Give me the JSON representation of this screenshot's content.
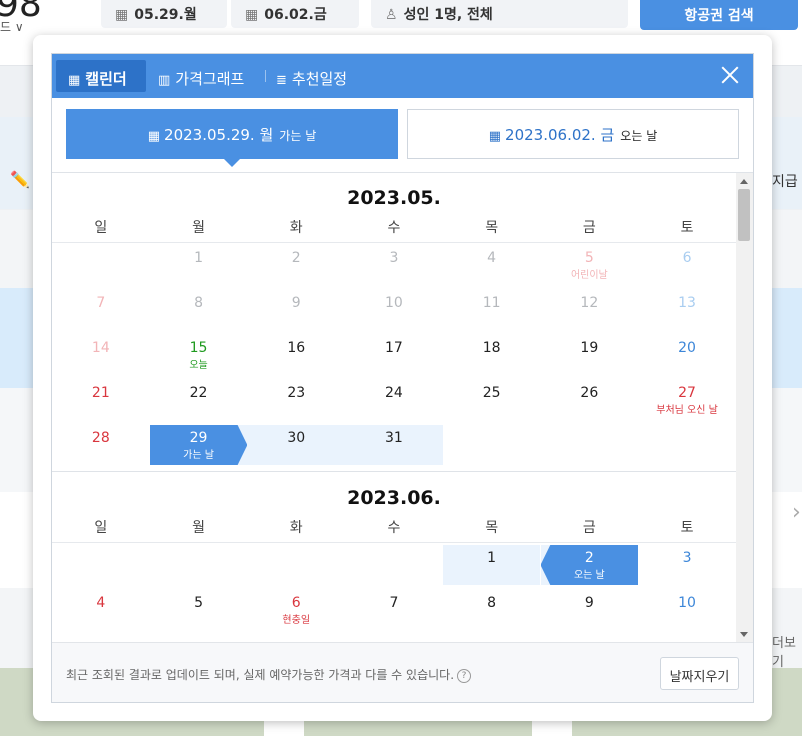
{
  "header": {
    "logo_fragment": "98",
    "logo_sub": "드 ∨",
    "depart_field": "05.29.월",
    "return_field": "06.02.금",
    "passenger_field": "성인 1명, 전체",
    "search_button": "항공권 검색"
  },
  "background": {
    "right_text_1": "지급",
    "right_text_2": "더보기",
    "chevron": "›"
  },
  "popup": {
    "tabs": [
      "캘린더",
      "가격그래프",
      "추천일정"
    ],
    "departure": {
      "date": "2023.05.29.",
      "weekday": "월",
      "label": "가는 날"
    },
    "return": {
      "date": "2023.06.02.",
      "weekday": "금",
      "label": "오는 날"
    },
    "weekdays": [
      "일",
      "월",
      "화",
      "수",
      "목",
      "금",
      "토"
    ],
    "footer_note": "최근 조회된 결과로 업데이트 되며, 실제 예약가능한 가격과 다를 수 있습니다.",
    "help_glyph": "?",
    "clear_button": "날짜지우기",
    "months": [
      {
        "title": "2023.05.",
        "days": [
          {
            "d": "1",
            "col": 1,
            "row": 0,
            "state": "past"
          },
          {
            "d": "2",
            "col": 2,
            "row": 0,
            "state": "past"
          },
          {
            "d": "3",
            "col": 3,
            "row": 0,
            "state": "past"
          },
          {
            "d": "4",
            "col": 4,
            "row": 0,
            "state": "past"
          },
          {
            "d": "5",
            "col": 5,
            "row": 0,
            "state": "past hol",
            "label": "어린이날"
          },
          {
            "d": "6",
            "col": 6,
            "row": 0,
            "state": "past sat"
          },
          {
            "d": "7",
            "col": 0,
            "row": 1,
            "state": "past sun"
          },
          {
            "d": "8",
            "col": 1,
            "row": 1,
            "state": "past"
          },
          {
            "d": "9",
            "col": 2,
            "row": 1,
            "state": "past"
          },
          {
            "d": "10",
            "col": 3,
            "row": 1,
            "state": "past"
          },
          {
            "d": "11",
            "col": 4,
            "row": 1,
            "state": "past"
          },
          {
            "d": "12",
            "col": 5,
            "row": 1,
            "state": "past"
          },
          {
            "d": "13",
            "col": 6,
            "row": 1,
            "state": "past sat"
          },
          {
            "d": "14",
            "col": 0,
            "row": 2,
            "state": "past sun"
          },
          {
            "d": "15",
            "col": 1,
            "row": 2,
            "state": "today",
            "label": "오늘"
          },
          {
            "d": "16",
            "col": 2,
            "row": 2,
            "state": ""
          },
          {
            "d": "17",
            "col": 3,
            "row": 2,
            "state": ""
          },
          {
            "d": "18",
            "col": 4,
            "row": 2,
            "state": ""
          },
          {
            "d": "19",
            "col": 5,
            "row": 2,
            "state": ""
          },
          {
            "d": "20",
            "col": 6,
            "row": 2,
            "state": "sat"
          },
          {
            "d": "21",
            "col": 0,
            "row": 3,
            "state": "sun"
          },
          {
            "d": "22",
            "col": 1,
            "row": 3,
            "state": ""
          },
          {
            "d": "23",
            "col": 2,
            "row": 3,
            "state": ""
          },
          {
            "d": "24",
            "col": 3,
            "row": 3,
            "state": ""
          },
          {
            "d": "25",
            "col": 4,
            "row": 3,
            "state": ""
          },
          {
            "d": "26",
            "col": 5,
            "row": 3,
            "state": ""
          },
          {
            "d": "27",
            "col": 6,
            "row": 3,
            "state": "hol",
            "label": "부처님 오신 날"
          },
          {
            "d": "28",
            "col": 0,
            "row": 4,
            "state": "sun"
          },
          {
            "d": "29",
            "col": 1,
            "row": 4,
            "state": "selected dep-sel",
            "label": "가는 날"
          },
          {
            "d": "30",
            "col": 2,
            "row": 4,
            "state": "range"
          },
          {
            "d": "31",
            "col": 3,
            "row": 4,
            "state": "range"
          }
        ]
      },
      {
        "title": "2023.06.",
        "days": [
          {
            "d": "1",
            "col": 4,
            "row": 0,
            "state": "range"
          },
          {
            "d": "2",
            "col": 5,
            "row": 0,
            "state": "selected ret-sel",
            "label": "오는 날"
          },
          {
            "d": "3",
            "col": 6,
            "row": 0,
            "state": "sat"
          },
          {
            "d": "4",
            "col": 0,
            "row": 1,
            "state": "sun"
          },
          {
            "d": "5",
            "col": 1,
            "row": 1,
            "state": ""
          },
          {
            "d": "6",
            "col": 2,
            "row": 1,
            "state": "hol",
            "label": "현충일"
          },
          {
            "d": "7",
            "col": 3,
            "row": 1,
            "state": ""
          },
          {
            "d": "8",
            "col": 4,
            "row": 1,
            "state": ""
          },
          {
            "d": "9",
            "col": 5,
            "row": 1,
            "state": ""
          },
          {
            "d": "10",
            "col": 6,
            "row": 1,
            "state": "sat"
          }
        ]
      }
    ]
  }
}
